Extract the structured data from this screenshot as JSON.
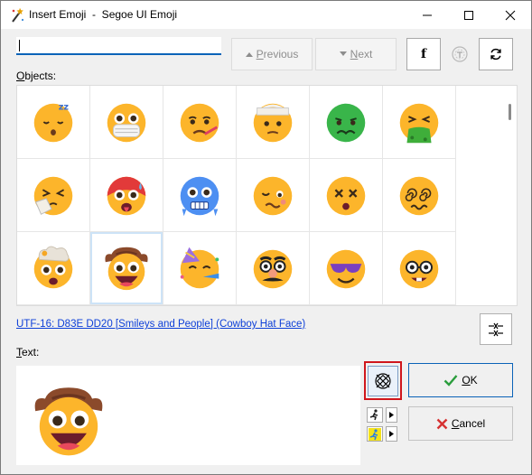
{
  "window": {
    "title": "Insert Emoji  -  Segoe UI Emoji"
  },
  "toolbar": {
    "search_value": "",
    "previous_label": "Previous",
    "previous_mnemonic": "P",
    "next_label": "Next",
    "next_mnemonic": "N",
    "font_button_label": "f"
  },
  "category": {
    "label": "Objects:",
    "mnemonic": "O"
  },
  "emoji_grid": {
    "rows": [
      [
        "sleeping-face",
        "face-with-medical-mask",
        "face-with-thermometer",
        "face-with-head-bandage",
        "nauseated-face",
        "face-vomiting"
      ],
      [
        "sneezing-face",
        "hot-face",
        "cold-face",
        "woozy-face",
        "dizzy-face",
        "face-with-spiral-eyes"
      ],
      [
        "exploding-head",
        "cowboy-hat-face",
        "partying-face",
        "disguised-face",
        "smiling-face-with-sunglasses",
        "nerd-face"
      ]
    ],
    "selected": "cowboy-hat-face"
  },
  "info": {
    "utf_text": "UTF-16: D83E DD20 [Smileys and People] (Cowboy Hat Face)"
  },
  "text_section": {
    "label": "Text:",
    "mnemonic": "T",
    "preview_emoji": "cowboy-hat-face"
  },
  "actions": {
    "ok_label": "OK",
    "ok_mnemonic": "O",
    "cancel_label": "Cancel",
    "cancel_mnemonic": "C"
  },
  "colors": {
    "accent": "#0a63b8",
    "highlight_border": "#d0161c",
    "emoji_yellow": "#fcb52b",
    "link": "#0d3fd8"
  }
}
